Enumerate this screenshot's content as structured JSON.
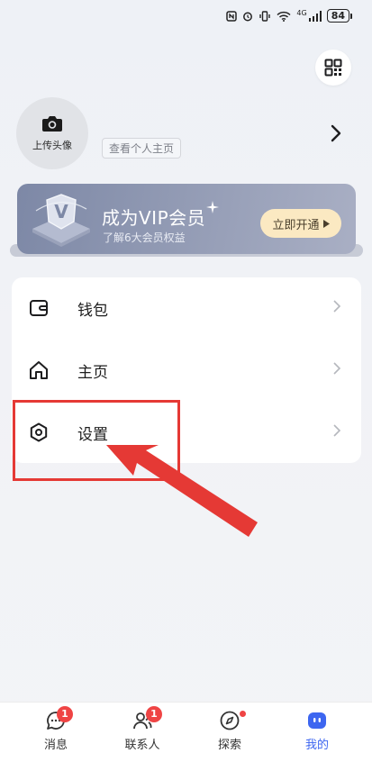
{
  "status_bar": {
    "signal_label": "4G",
    "battery": "84"
  },
  "profile": {
    "upload_avatar_label": "上传头像",
    "view_profile_label": "查看个人主页"
  },
  "vip": {
    "title": "成为VIP会员",
    "subtitle": "了解6大会员权益",
    "cta_label": "立即开通",
    "badge_letter": "V"
  },
  "menu": {
    "items": [
      {
        "label": "钱包",
        "icon": "wallet-icon"
      },
      {
        "label": "主页",
        "icon": "home-icon"
      },
      {
        "label": "设置",
        "icon": "settings-icon"
      }
    ]
  },
  "bottom_nav": {
    "items": [
      {
        "label": "消息",
        "icon": "chat-bubble-icon",
        "badge": "1",
        "active": false
      },
      {
        "label": "联系人",
        "icon": "contacts-icon",
        "badge": "1",
        "active": false
      },
      {
        "label": "探索",
        "icon": "compass-icon",
        "dot": true,
        "active": false
      },
      {
        "label": "我的",
        "icon": "robot-face-icon",
        "active": true
      }
    ]
  },
  "colors": {
    "accent": "#3d66f0",
    "badge": "#ef4444",
    "annotation": "#e53935",
    "vip_button": "#fbe9c2"
  }
}
